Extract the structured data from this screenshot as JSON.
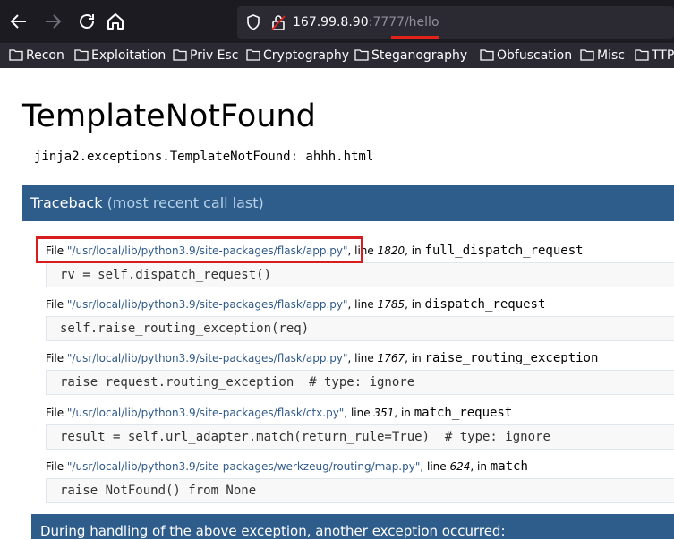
{
  "browser": {
    "nav": {
      "back_icon": "arrow-left-icon",
      "forward_icon": "arrow-right-icon",
      "reload_icon": "reload-icon",
      "home_icon": "home-icon"
    },
    "url": {
      "host": "167.99.8.90",
      "port": ":7777",
      "path": "/hello"
    },
    "bookmarks": [
      "Recon",
      "Exploitation",
      "Priv Esc",
      "Cryptography",
      "Steganography",
      "Obfuscation",
      "Misc",
      "TTP"
    ],
    "colors": {
      "chrome": "#1c1b22",
      "urlbar": "#2b2a33",
      "annotation": "#e2231a"
    }
  },
  "page": {
    "title": "TemplateNotFound",
    "exception": "jinja2.exceptions.TemplateNotFound: ahhh.html",
    "traceback_title": "Traceback",
    "traceback_subtitle": "(most recent call last)",
    "frames": [
      {
        "file_prefix": "File ",
        "file": "\"/usr/local/lib/python3.9/site-packages/flask/app.py\"",
        "line_prefix": ", line ",
        "line": "1820",
        "in_text": ", in ",
        "func": "full_dispatch_request",
        "code": "rv = self.dispatch_request()"
      },
      {
        "file_prefix": "File ",
        "file": "\"/usr/local/lib/python3.9/site-packages/flask/app.py\"",
        "line_prefix": ", line ",
        "line": "1785",
        "in_text": ", in ",
        "func": "dispatch_request",
        "code": "self.raise_routing_exception(req)"
      },
      {
        "file_prefix": "File ",
        "file": "\"/usr/local/lib/python3.9/site-packages/flask/app.py\"",
        "line_prefix": ", line ",
        "line": "1767",
        "in_text": ", in ",
        "func": "raise_routing_exception",
        "code": "raise request.routing_exception  # type: ignore"
      },
      {
        "file_prefix": "File ",
        "file": "\"/usr/local/lib/python3.9/site-packages/flask/ctx.py\"",
        "line_prefix": ", line ",
        "line": "351",
        "in_text": ", in ",
        "func": "match_request",
        "code": "result = self.url_adapter.match(return_rule=True)  # type: ignore"
      },
      {
        "file_prefix": "File ",
        "file": "\"/usr/local/lib/python3.9/site-packages/werkzeug/routing/map.py\"",
        "line_prefix": ", line ",
        "line": "624",
        "in_text": ", in ",
        "func": "match",
        "code": "raise NotFound() from None"
      }
    ],
    "footer": "During handling of the above exception, another exception occurred:",
    "colors": {
      "traceback_header": "#2e5d8c",
      "filename": "#2f5a8a",
      "highlight": "#d71d1d"
    }
  }
}
